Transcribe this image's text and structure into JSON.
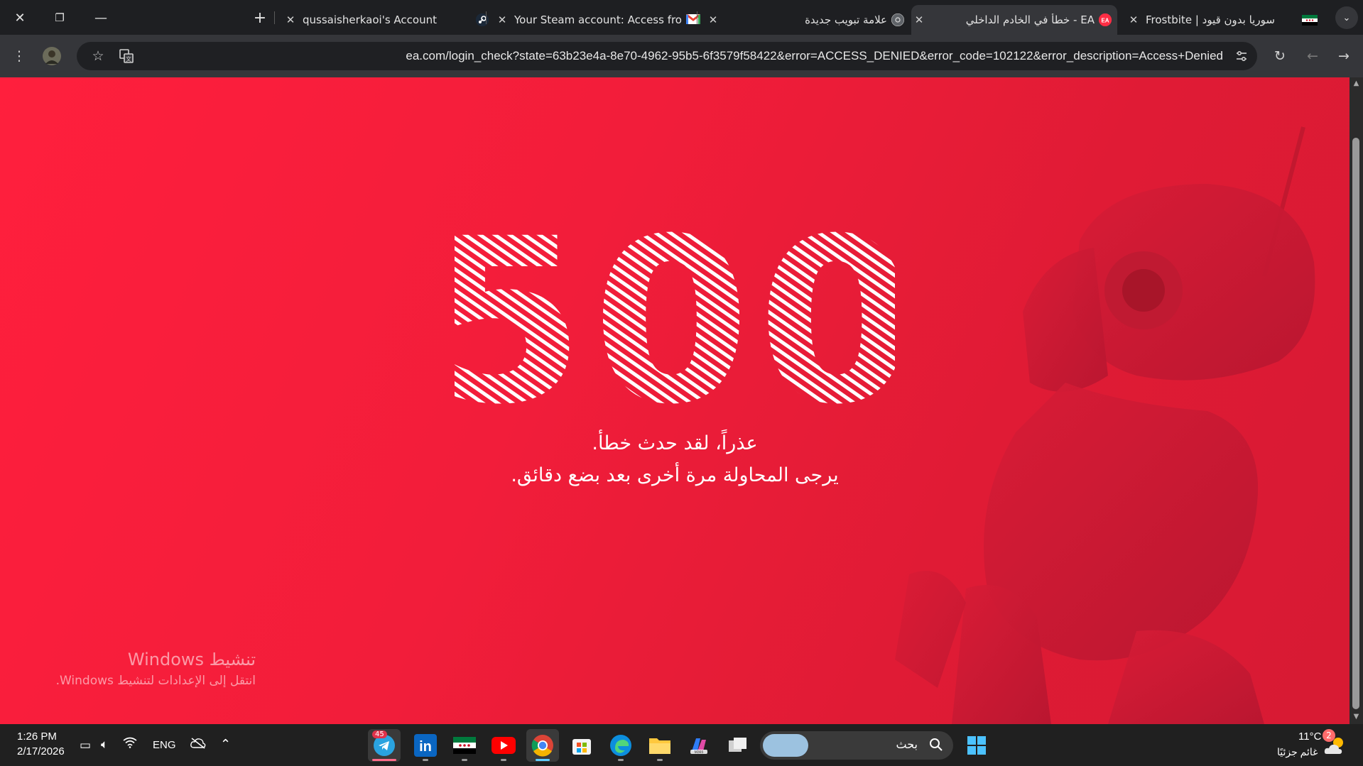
{
  "browser": {
    "tabs": [
      {
        "title": "qussaisherkaoi's Account",
        "favicon": "steam-icon"
      },
      {
        "title": "Your Steam account: Access fro",
        "favicon": "gmail-icon"
      },
      {
        "title": "علامة تبويب جديدة",
        "favicon": "chrome-icon"
      },
      {
        "title": "EA - خطأ في الخادم الداخلي",
        "favicon": "ea-icon",
        "active": true
      },
      {
        "title": "Frostbite | سوريا بدون قيود",
        "favicon": "syria-flag-icon"
      }
    ],
    "url": "ea.com/login_check?state=63b23e4a-8e70-4962-95b5-6f3579f58422&error=ACCESS_DENIED&error_code=102122&error_description=Access+Denied"
  },
  "page": {
    "error_code": "500",
    "message_line1": "عذراً، لقد حدث خطأ.",
    "message_line2": "يرجى المحاولة مرة أخرى بعد بضع دقائق.",
    "background_color": "#f01f3a"
  },
  "watermark": {
    "title": "تنشيط Windows",
    "subtitle": "انتقل إلى الإعدادات لتنشيط Windows."
  },
  "taskbar": {
    "time": "1:26 PM",
    "date": "2/17/2026",
    "language": "ENG",
    "search_placeholder": "بحث",
    "telegram_badge": "45",
    "weather_temp": "11°C",
    "weather_desc": "غائم جزئيًا",
    "weather_badge": "2"
  }
}
